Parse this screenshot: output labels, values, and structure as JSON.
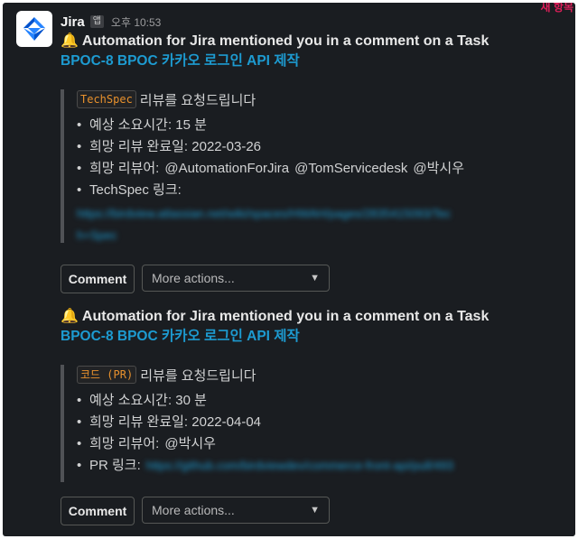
{
  "new_badge": "새 항목",
  "app": {
    "name": "Jira",
    "badge": "앱",
    "timestamp": "오후 10:53"
  },
  "messages": [
    {
      "title": "Automation for Jira mentioned you in a comment on a Task",
      "issue": "BPOC-8 BPOC 카카오 로그인 API 제작",
      "tag": "TechSpec",
      "request_text": "리뷰를 요청드립니다",
      "items": [
        {
          "text": "예상 소요시간: 15 분"
        },
        {
          "text": "희망 리뷰 완료일: 2022-03-26"
        },
        {
          "text": "희망 리뷰어:",
          "mentions": [
            "@AutomationForJira",
            "@TomServicedesk",
            "@박시우"
          ]
        },
        {
          "text": "TechSpec 링크:"
        }
      ],
      "link_text_1": "https://birdview.atlassian.net/wiki/spaces/HWAH/pages/2835415093/Tec",
      "link_text_2": "h+Spec",
      "button_label": "Comment",
      "select_placeholder": "More actions..."
    },
    {
      "title": "Automation for Jira mentioned you in a comment on a Task",
      "issue": "BPOC-8 BPOC 카카오 로그인 API 제작",
      "tag": "코드 (PR)",
      "request_text": "리뷰를 요청드립니다",
      "items": [
        {
          "text": "예상 소요시간: 30 분"
        },
        {
          "text": "희망 리뷰 완료일: 2022-04-04"
        },
        {
          "text": "희망 리뷰어:",
          "mentions": [
            "@박시우"
          ]
        },
        {
          "text": "PR 링크:"
        }
      ],
      "link_text": "https://github.com/birdviewdev/commerce-front-api/pull/493",
      "button_label": "Comment",
      "select_placeholder": "More actions..."
    }
  ]
}
